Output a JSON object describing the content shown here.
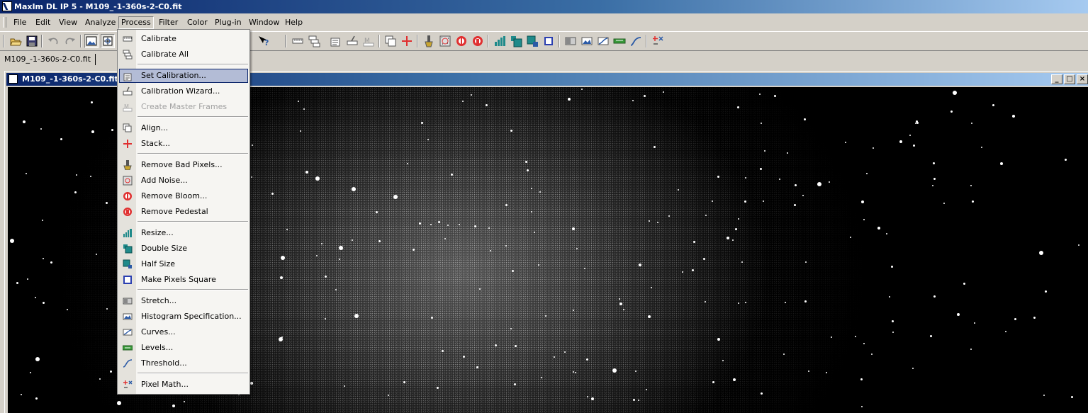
{
  "window": {
    "title": "MaxIm DL IP 5 - M109_-1-360s-2-C0.fit"
  },
  "menubar": {
    "items": [
      "File",
      "Edit",
      "View",
      "Analyze",
      "Process",
      "Filter",
      "Color",
      "Plug-in",
      "Window",
      "Help"
    ],
    "open_menu": "Process"
  },
  "tabs": {
    "active": "M109_-1-360s-2-C0.fit"
  },
  "document": {
    "title": "M109_-1-360s-2-C0.fit",
    "controls": {
      "minimize": "_",
      "maximize": "□",
      "close": "×"
    }
  },
  "process_menu": {
    "items": [
      {
        "label": "Calibrate",
        "icon": "calibrate-icon",
        "enabled": true
      },
      {
        "label": "Calibrate All",
        "icon": "calibrate-all-icon",
        "enabled": true
      },
      {
        "label": "Set Calibration...",
        "icon": "set-calibration-icon",
        "enabled": true,
        "highlighted": true
      },
      {
        "label": "Calibration Wizard...",
        "icon": "calibration-wizard-icon",
        "enabled": true
      },
      {
        "label": "Create Master Frames",
        "icon": "master-frames-icon",
        "enabled": false
      },
      {
        "label": "Align...",
        "icon": "align-icon",
        "enabled": true
      },
      {
        "label": "Stack...",
        "icon": "stack-icon",
        "enabled": true
      },
      {
        "label": "Remove Bad Pixels...",
        "icon": "bad-pixels-icon",
        "enabled": true
      },
      {
        "label": "Add Noise...",
        "icon": "add-noise-icon",
        "enabled": true
      },
      {
        "label": "Remove Bloom...",
        "icon": "remove-bloom-icon",
        "enabled": true
      },
      {
        "label": "Remove Pedestal",
        "icon": "remove-pedestal-icon",
        "enabled": true
      },
      {
        "label": "Resize...",
        "icon": "resize-icon",
        "enabled": true
      },
      {
        "label": "Double Size",
        "icon": "double-size-icon",
        "enabled": true
      },
      {
        "label": "Half Size",
        "icon": "half-size-icon",
        "enabled": true
      },
      {
        "label": "Make Pixels Square",
        "icon": "square-pixels-icon",
        "enabled": true
      },
      {
        "label": "Stretch...",
        "icon": "stretch-icon",
        "enabled": true
      },
      {
        "label": "Histogram Specification...",
        "icon": "histogram-icon",
        "enabled": true
      },
      {
        "label": "Curves...",
        "icon": "curves-icon",
        "enabled": true
      },
      {
        "label": "Levels...",
        "icon": "levels-icon",
        "enabled": true
      },
      {
        "label": "Threshold...",
        "icon": "threshold-icon",
        "enabled": true
      },
      {
        "label": "Pixel Math...",
        "icon": "pixel-math-icon",
        "enabled": true
      }
    ]
  },
  "colors": {
    "titlebar_start": "#0a246a",
    "titlebar_end": "#a6caf0",
    "menu_highlight": "#b3bcd6",
    "chrome": "#d4d0c8",
    "accent_red": "#e03030",
    "accent_teal": "#1f8a8a"
  }
}
